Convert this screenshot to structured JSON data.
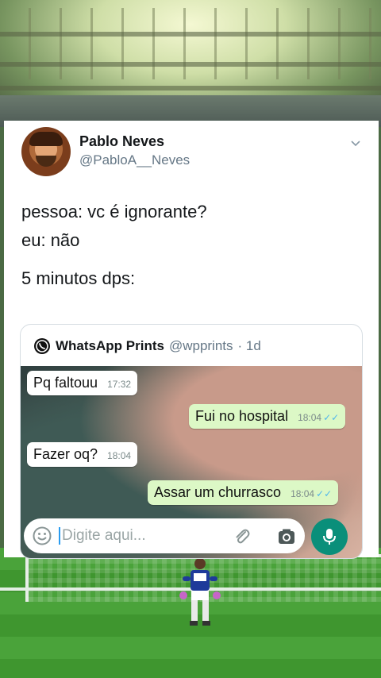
{
  "tweet": {
    "author_name": "Pablo Neves",
    "author_handle": "@PabloA__Neves",
    "lines": [
      "pessoa: vc é ignorante?",
      "eu: não",
      "5 minutos dps:"
    ]
  },
  "quoted": {
    "name": "WhatsApp Prints",
    "handle": "@wpprints",
    "age": "· 1d"
  },
  "chat": {
    "messages": [
      {
        "text": "Pq faltouu",
        "time": "17:32",
        "direction": "in"
      },
      {
        "text": "Fui no hospital",
        "time": "18:04",
        "direction": "out"
      },
      {
        "text": "Fazer oq?",
        "time": "18:04",
        "direction": "in"
      },
      {
        "text": "Assar um churrasco",
        "time": "18:04",
        "direction": "out"
      }
    ],
    "input_placeholder": "Digite aqui..."
  },
  "icons": {
    "chevron": "chevron-down-icon",
    "whatsapp": "whatsapp-icon",
    "emoji": "emoji-icon",
    "attach": "paperclip-icon",
    "camera": "camera-icon",
    "mic": "microphone-icon"
  },
  "colors": {
    "out_bubble": "#dcf8c6",
    "in_bubble": "#ffffff",
    "mic_button": "#0a8f7a",
    "read_ticks": "#4fb6ec"
  }
}
